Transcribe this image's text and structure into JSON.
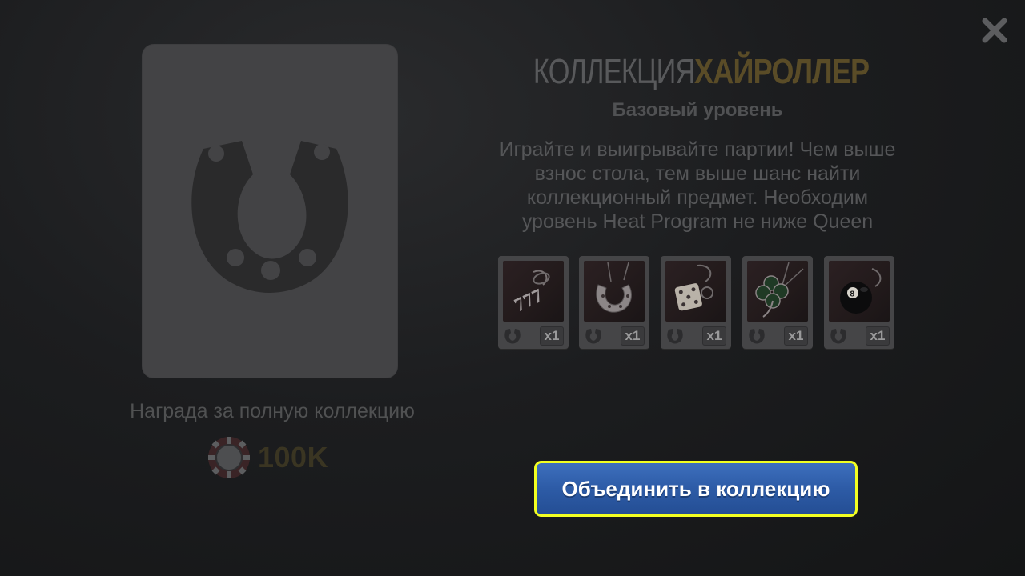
{
  "close": {
    "icon": "close-icon"
  },
  "reward": {
    "card_icon": "horseshoe-icon",
    "label": "Награда за полную коллекцию",
    "amount": "100K",
    "chip_icon": "poker-chip-icon"
  },
  "header": {
    "title_prefix": "КОЛЛЕКЦИЯ",
    "title_name": "ХАЙРОЛЛЕР",
    "subtitle": "Базовый уровень"
  },
  "description": {
    "lines": [
      "Играйте и выигрывайте партии! Чем выше",
      "взнос стола, тем выше шанс найти",
      "коллекционный предмет. Необходим",
      "уровень Heat Program не ниже Queen"
    ]
  },
  "items": [
    {
      "name": "777-keychain",
      "qty": "x1"
    },
    {
      "name": "horseshoe-pendant",
      "qty": "x1"
    },
    {
      "name": "dice-keychain",
      "qty": "x1"
    },
    {
      "name": "clover-pendant",
      "qty": "x1"
    },
    {
      "name": "eight-ball-keychain",
      "qty": "x1"
    }
  ],
  "actions": {
    "combine_label": "Объединить в коллекцию"
  },
  "colors": {
    "accent_border": "#f2ff22",
    "button_blue": "#2d5ba6",
    "title_gold": "#5a4c27"
  }
}
